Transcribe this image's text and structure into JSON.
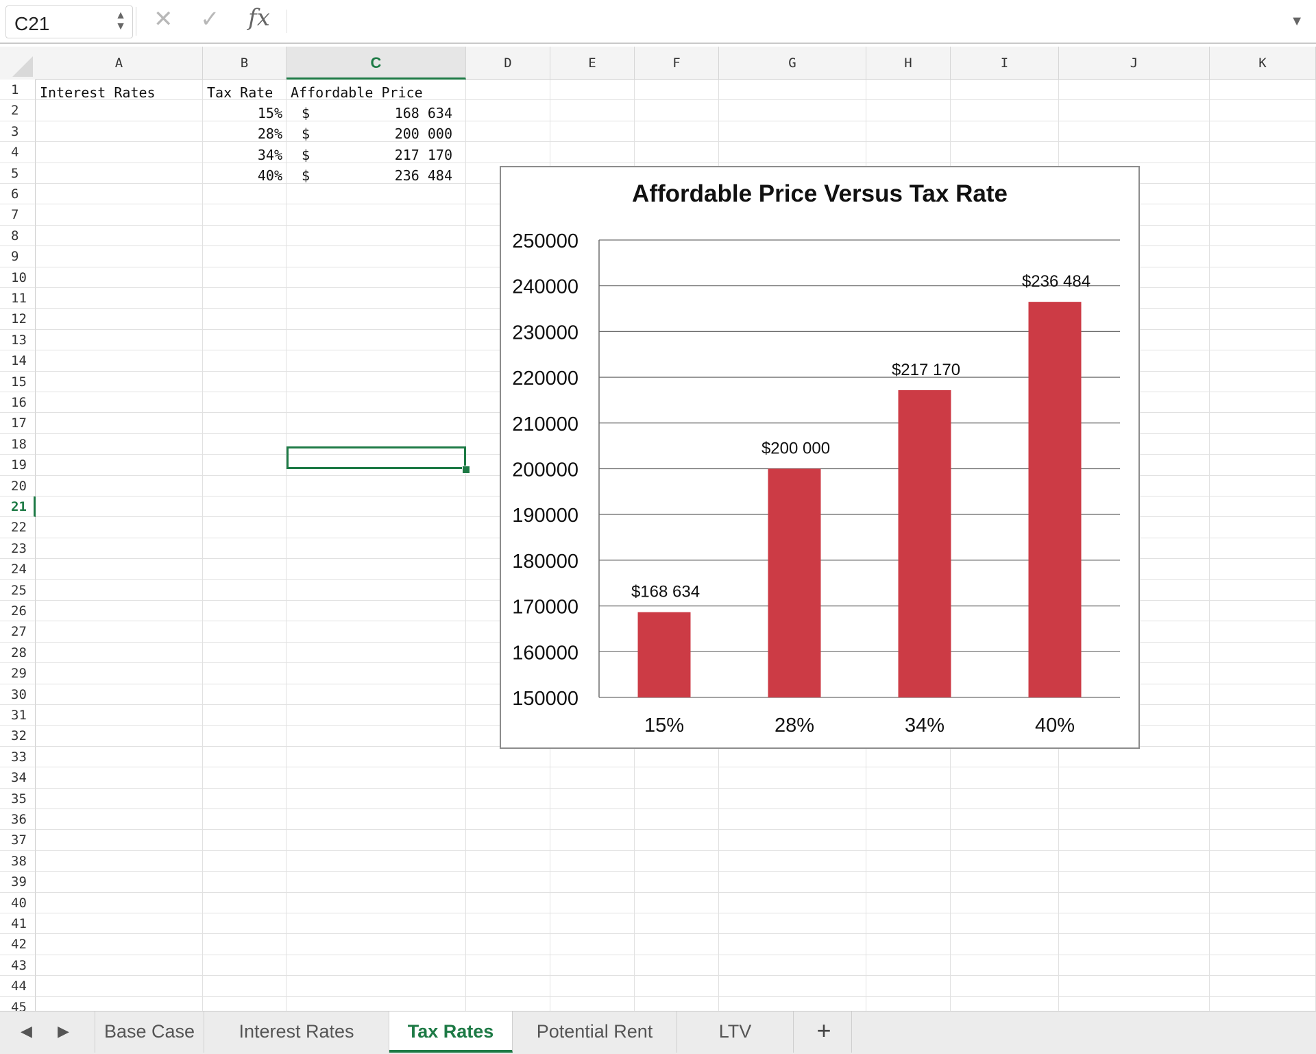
{
  "formula_bar": {
    "name_box": "C21",
    "formula": "",
    "fx_label": "fx"
  },
  "columns": [
    "A",
    "B",
    "C",
    "D",
    "E",
    "F",
    "G",
    "H",
    "I",
    "J",
    "K"
  ],
  "active_column": "C",
  "active_row": 21,
  "row_count": 45,
  "cells": {
    "A1": "Interest Rates",
    "B1": "Tax Rate",
    "C1": "Affordable Price",
    "B2": "15%",
    "C2_currency": "$",
    "C2": "168 634",
    "B3": "28%",
    "C3_currency": "$",
    "C3": "200 000",
    "B4": "34%",
    "C4_currency": "$",
    "C4": "217 170",
    "B5": "40%",
    "C5_currency": "$",
    "C5": "236 484"
  },
  "chart_data": {
    "type": "bar",
    "title": "Affordable Price Versus Tax Rate",
    "categories": [
      "15%",
      "28%",
      "34%",
      "40%"
    ],
    "values": [
      168634,
      200000,
      217170,
      236484
    ],
    "data_labels": [
      "$168 634",
      "$200 000",
      "$217 170",
      "$236 484"
    ],
    "ylim": [
      150000,
      250000
    ],
    "yticks": [
      "150000",
      "160000",
      "170000",
      "180000",
      "190000",
      "200000",
      "210000",
      "220000",
      "230000",
      "240000",
      "250000"
    ],
    "grid": true,
    "bar_color": "#cc3b45"
  },
  "sheet_tabs": [
    "Base Case",
    "Interest Rates",
    "Tax Rates",
    "Potential Rent",
    "LTV"
  ],
  "active_tab": "Tax Rates",
  "add_sheet_label": "+"
}
